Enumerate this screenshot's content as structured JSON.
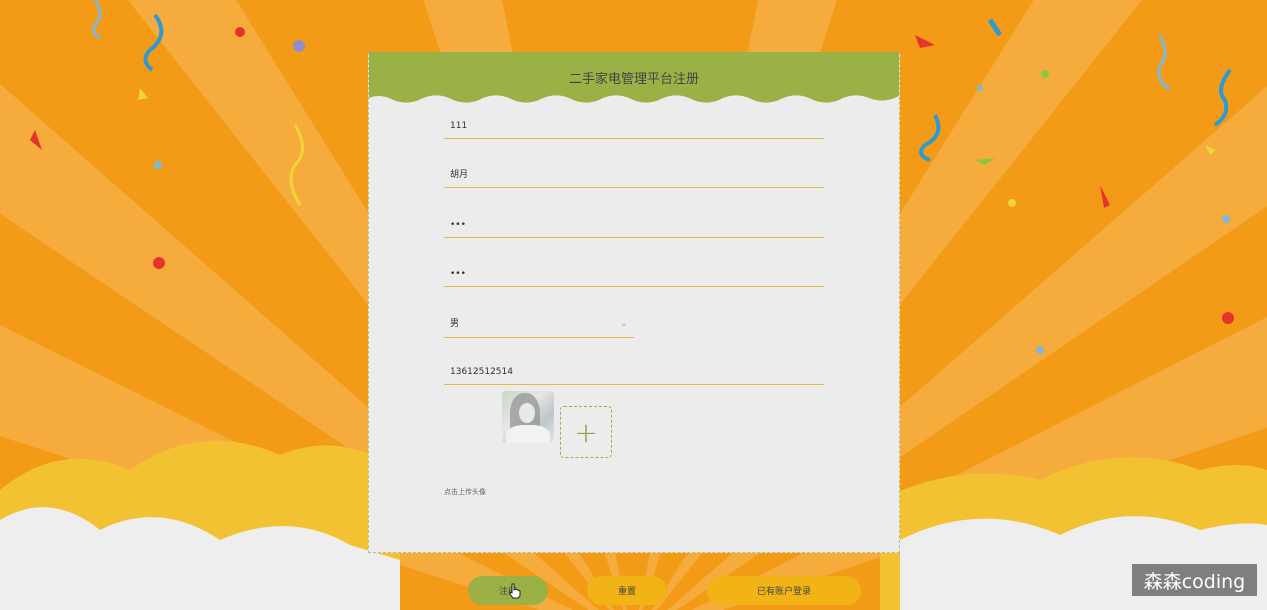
{
  "form": {
    "title": "二手家电管理平台注册",
    "account": "111",
    "name": "胡月",
    "password": "•••",
    "confirm_password": "•••",
    "gender": "男",
    "phone": "13612512514",
    "avatar_hint": "点击上传头像"
  },
  "buttons": {
    "register": "注册",
    "reset": "重置",
    "login": "已有账户登录"
  },
  "watermark": "森森coding",
  "colors": {
    "background": "#f39a17",
    "header": "#9bb145",
    "field_line": "#e8b64a",
    "button_yellow": "#f1b315",
    "button_green": "#9bb145"
  },
  "icons": {
    "select_arrow": "chevron-down-icon",
    "upload": "plus-icon",
    "cursor": "hand-pointer-icon"
  }
}
